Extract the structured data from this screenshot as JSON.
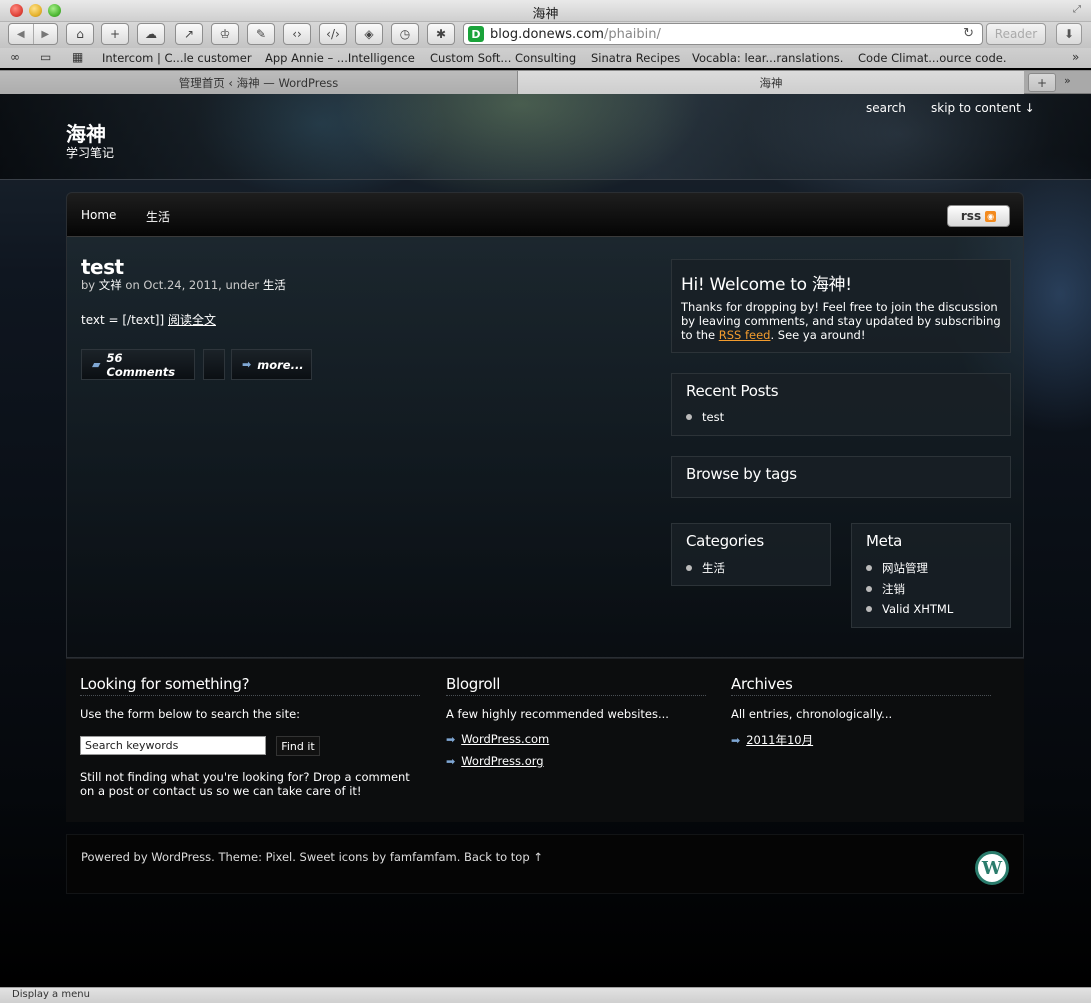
{
  "browser": {
    "window_title": "海神",
    "url_host": "blog.donews.com",
    "url_path": "/phaibin/",
    "url_favicon": "D",
    "reader_label": "Reader",
    "toolbar_icons": [
      "home-icon",
      "add-icon",
      "cloud-icon",
      "share-icon",
      "crown-icon",
      "pin-icon",
      "code-icon",
      "code-slash-icon",
      "layers-icon",
      "clock-icon",
      "bug-icon"
    ],
    "bookmarks": [
      "Intercom | C...le customer",
      "App Annie – ...Intelligence",
      "Custom Soft... Consulting",
      "Sinatra Recipes",
      "Vocabla: lear...ranslations.",
      "Code Climat...ource code."
    ],
    "tabs": [
      {
        "label": "管理首页 ‹ 海神 — WordPress"
      },
      {
        "label": "海神"
      }
    ],
    "status": "Display a menu"
  },
  "site": {
    "title": "海神",
    "description": "学习笔记",
    "top_links": {
      "search": "search",
      "skip": "skip to content ↓"
    }
  },
  "nav": {
    "items": [
      "Home",
      "生活"
    ],
    "rss_label": "rss"
  },
  "post": {
    "title": "test",
    "meta_by": "by",
    "meta_author": "文祥",
    "meta_on": "on Oct.24, 2011, under",
    "meta_category": "生活",
    "body": "text = [/text]]",
    "more_link": "阅读全文",
    "comments_btn": "56 Comments",
    "more_btn": "more..."
  },
  "sidebar": {
    "welcome_title": "Hi! Welcome to 海神!",
    "welcome_text_before": "Thanks for dropping by! Feel free to join the discussion by leaving comments, and stay updated by subscribing to the ",
    "welcome_rss": "RSS feed",
    "welcome_text_after": ". See ya around!",
    "recent_title": "Recent Posts",
    "recent_items": [
      "test"
    ],
    "tags_title": "Browse by tags",
    "categories_title": "Categories",
    "categories_items": [
      "生活"
    ],
    "meta_title": "Meta",
    "meta_items": [
      "网站管理",
      "注销",
      "Valid XHTML"
    ]
  },
  "footer": {
    "search_title": "Looking for something?",
    "search_intro": "Use the form below to search the site:",
    "search_placeholder": "Search keywords",
    "search_button": "Find it",
    "search_help": "Still not finding what you're looking for? Drop a comment on a post or contact us so we can take care of it!",
    "blogroll_title": "Blogroll",
    "blogroll_intro": "A few highly recommended websites...",
    "blogroll_links": [
      "WordPress.com",
      "WordPress.org"
    ],
    "archives_title": "Archives",
    "archives_intro": "All entries, chronologically...",
    "archives_links": [
      "2011年10月"
    ],
    "credits": "Powered by WordPress. Theme: Pixel. Sweet icons by famfamfam. Back to top ↑",
    "wp_logo_letter": "W"
  }
}
